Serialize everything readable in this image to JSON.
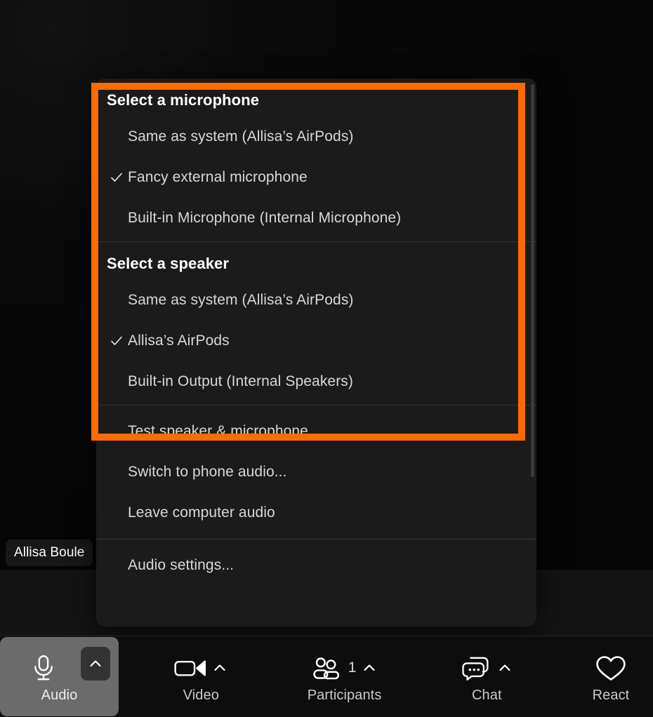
{
  "video": {
    "participant_name": "Allisa Boule"
  },
  "audio_menu": {
    "microphone_section": {
      "header": "Select a microphone",
      "items": [
        {
          "label": "Same as system (Allisa’s AirPods)",
          "checked": false
        },
        {
          "label": "Fancy external microphone",
          "checked": true
        },
        {
          "label": "Built-in Microphone (Internal Microphone)",
          "checked": false
        }
      ]
    },
    "speaker_section": {
      "header": "Select a speaker",
      "items": [
        {
          "label": "Same as system (Allisa’s AirPods)",
          "checked": false
        },
        {
          "label": "Allisa’s AirPods",
          "checked": true
        },
        {
          "label": "Built-in Output (Internal Speakers)",
          "checked": false
        }
      ]
    },
    "actions": [
      {
        "label": "Test speaker & microphone..."
      },
      {
        "label": "Switch to phone audio..."
      },
      {
        "label": "Leave computer audio"
      }
    ],
    "settings": [
      {
        "label": "Audio settings..."
      }
    ]
  },
  "highlight": {
    "color": "#FF6B00"
  },
  "toolbar": {
    "audio": {
      "label": "Audio",
      "icon": "microphone-icon",
      "caret": "chevron-up-icon"
    },
    "video": {
      "label": "Video",
      "icon": "camera-icon",
      "caret": "chevron-up-icon"
    },
    "participants": {
      "label": "Participants",
      "icon": "participants-icon",
      "count": "1",
      "caret": "chevron-up-icon"
    },
    "chat": {
      "label": "Chat",
      "icon": "chat-bubble-icon",
      "caret": "chevron-up-icon"
    },
    "react": {
      "label": "React",
      "icon": "heart-icon"
    }
  }
}
